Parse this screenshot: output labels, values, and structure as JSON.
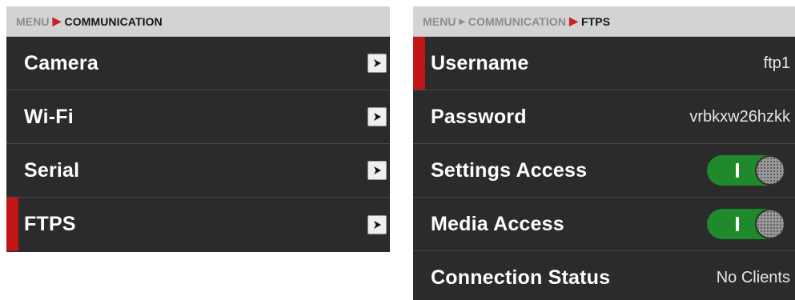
{
  "left_panel": {
    "breadcrumb": {
      "menu": "MENU",
      "current": "COMMUNICATION"
    },
    "items": [
      {
        "label": "Camera",
        "selected": false
      },
      {
        "label": "Wi-Fi",
        "selected": false
      },
      {
        "label": "Serial",
        "selected": false
      },
      {
        "label": "FTPS",
        "selected": true
      }
    ]
  },
  "right_panel": {
    "breadcrumb": {
      "menu": "MENU",
      "parent": "COMMUNICATION",
      "current": "FTPS"
    },
    "rows": {
      "username": {
        "label": "Username",
        "value": "ftp1"
      },
      "password": {
        "label": "Password",
        "value": "vrbkxw26hzkk"
      },
      "settings_access": {
        "label": "Settings Access",
        "enabled": true
      },
      "media_access": {
        "label": "Media Access",
        "enabled": true
      },
      "connection_status": {
        "label": "Connection Status",
        "value": "No Clients"
      }
    }
  },
  "colors": {
    "accent_red": "#c21616",
    "toggle_green": "#1e8a2b",
    "panel_background": "#2b2b2b",
    "breadcrumb_background": "#d3d3d3"
  },
  "icons": {
    "submenu_arrow": "chevron-right-icon",
    "toggle_knob": "toggle-knob"
  }
}
